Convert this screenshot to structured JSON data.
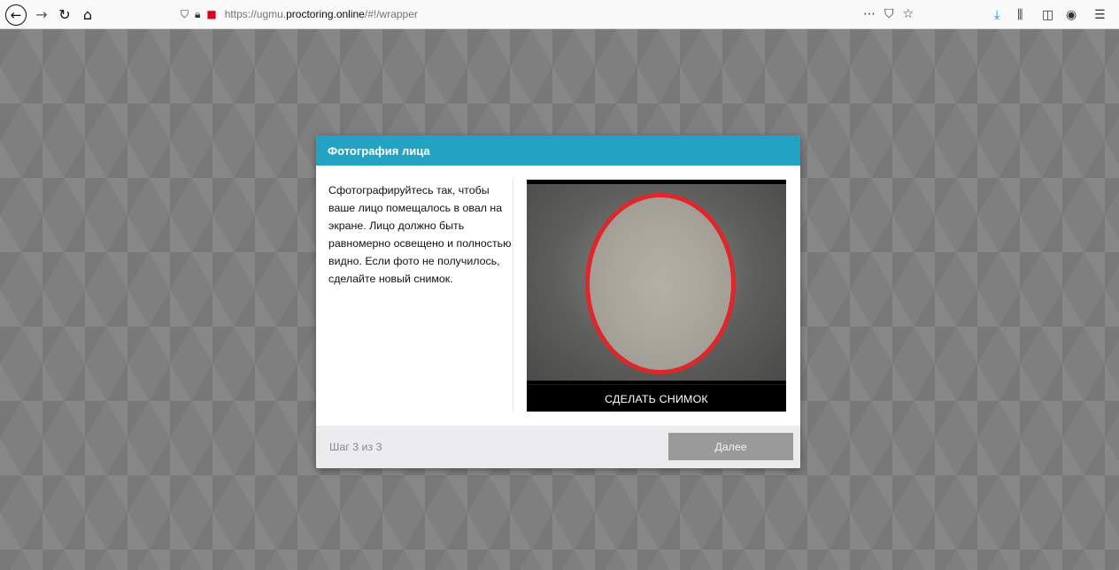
{
  "browser": {
    "url_prefix": "https://ugmu.",
    "url_domain": "proctoring.online",
    "url_suffix": "/#!/wrapper",
    "icons": {
      "back": "arrow-left",
      "forward": "arrow-right",
      "reload": "reload",
      "home": "home",
      "shield": "tracking-shield",
      "lock": "padlock",
      "camera": "camera-active",
      "more": "ellipsis",
      "pocket": "pocket",
      "bookmark": "star",
      "download": "download",
      "library": "library",
      "sidebar": "sidebar",
      "account": "account",
      "menu": "hamburger-menu"
    },
    "colors": {
      "camera_indicator": "#d70022",
      "download": "#0a84ff"
    }
  },
  "modal": {
    "title": "Фотография лица",
    "instructions": "Сфотографируйтесь так, чтобы ваше лицо помещалось в овал на экране. Лицо должно быть равномерно освещено и полностью видно. Если фото не получилось, сделайте новый снимок.",
    "snapshot_button": "СДЕЛАТЬ СНИМОК",
    "step_text": "Шаг 3 из 3",
    "next_button": "Далее",
    "colors": {
      "header": "#22a3c4",
      "oval_border": "#e0262a",
      "next_button_disabled": "#9a9a9a"
    }
  }
}
